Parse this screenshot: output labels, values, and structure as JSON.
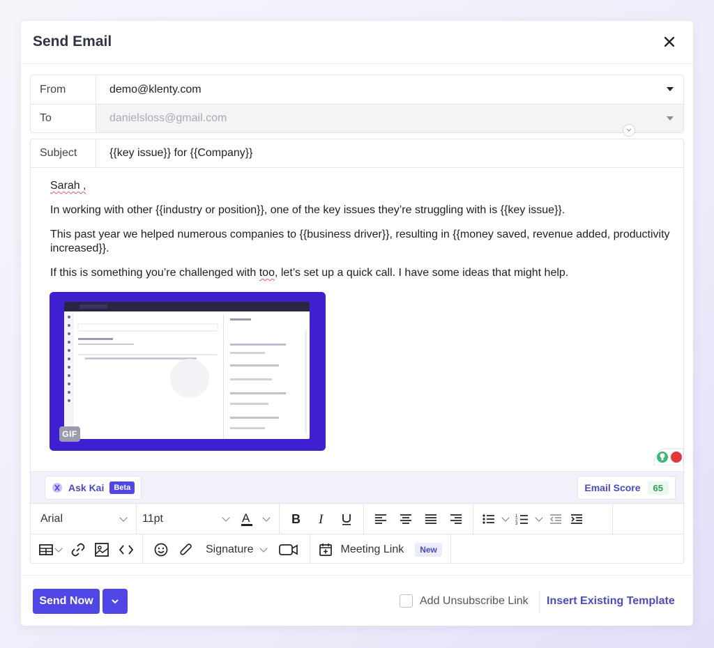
{
  "modal": {
    "title": "Send Email"
  },
  "from": {
    "label": "From",
    "value": "demo@klenty.com"
  },
  "to": {
    "label": "To",
    "value": "danielsloss@gmail.com"
  },
  "subject": {
    "label": "Subject",
    "value": "{{key issue}} for {{Company}}"
  },
  "body": {
    "greeting": "Sarah ,",
    "p1": "In working with other {{industry or position}}, one of the key issues they’re struggling with is {{key issue}}.",
    "p2_line1": "This past year we helped numerous companies to {{business driver}}, resulting in {{money saved, revenue added, productivity",
    "p2_line2": "increased}}.",
    "p3_before": "If this is something you’re challenged with ",
    "p3_marked": "too",
    "p3_after": ", let’s set up a quick call. I have some ideas that might help.",
    "gif_badge": "GIF"
  },
  "kai": {
    "label": "Ask Kai",
    "badge": "Beta"
  },
  "score": {
    "label": "Email Score",
    "value": "65"
  },
  "toolbar": {
    "font_family": "Arial",
    "font_size": "11pt",
    "signature": "Signature",
    "meeting_link": "Meeting Link",
    "meeting_badge": "New"
  },
  "footer": {
    "send_now": "Send Now",
    "unsubscribe": "Add Unsubscribe Link",
    "insert_template": "Insert Existing Template"
  },
  "colors": {
    "accent": "#4f46e5",
    "gif_bg": "#3f1fd0",
    "score_green": "#2f9e5b"
  }
}
